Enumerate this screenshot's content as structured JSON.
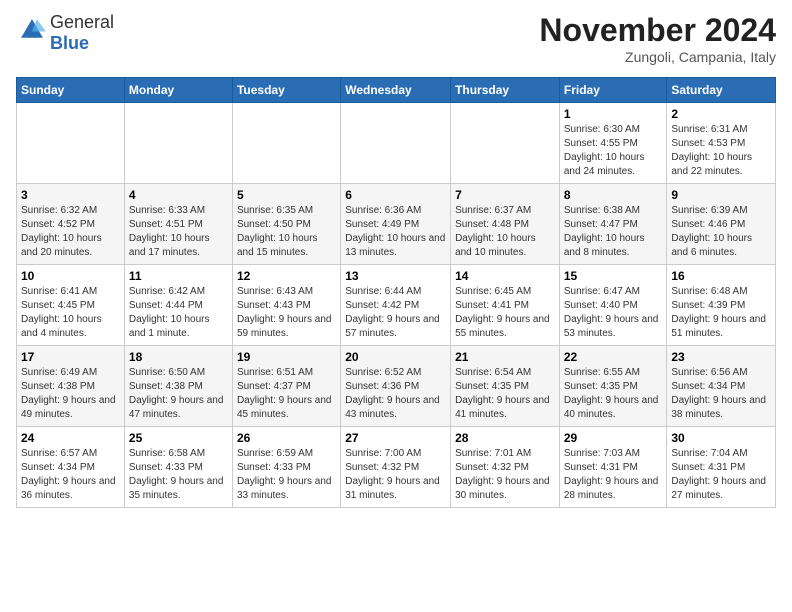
{
  "header": {
    "logo": {
      "general": "General",
      "blue": "Blue"
    },
    "title": "November 2024",
    "location": "Zungoli, Campania, Italy"
  },
  "days_header": [
    "Sunday",
    "Monday",
    "Tuesday",
    "Wednesday",
    "Thursday",
    "Friday",
    "Saturday"
  ],
  "weeks": [
    [
      {
        "day": "",
        "info": ""
      },
      {
        "day": "",
        "info": ""
      },
      {
        "day": "",
        "info": ""
      },
      {
        "day": "",
        "info": ""
      },
      {
        "day": "",
        "info": ""
      },
      {
        "day": "1",
        "info": "Sunrise: 6:30 AM\nSunset: 4:55 PM\nDaylight: 10 hours and 24 minutes."
      },
      {
        "day": "2",
        "info": "Sunrise: 6:31 AM\nSunset: 4:53 PM\nDaylight: 10 hours and 22 minutes."
      }
    ],
    [
      {
        "day": "3",
        "info": "Sunrise: 6:32 AM\nSunset: 4:52 PM\nDaylight: 10 hours and 20 minutes."
      },
      {
        "day": "4",
        "info": "Sunrise: 6:33 AM\nSunset: 4:51 PM\nDaylight: 10 hours and 17 minutes."
      },
      {
        "day": "5",
        "info": "Sunrise: 6:35 AM\nSunset: 4:50 PM\nDaylight: 10 hours and 15 minutes."
      },
      {
        "day": "6",
        "info": "Sunrise: 6:36 AM\nSunset: 4:49 PM\nDaylight: 10 hours and 13 minutes."
      },
      {
        "day": "7",
        "info": "Sunrise: 6:37 AM\nSunset: 4:48 PM\nDaylight: 10 hours and 10 minutes."
      },
      {
        "day": "8",
        "info": "Sunrise: 6:38 AM\nSunset: 4:47 PM\nDaylight: 10 hours and 8 minutes."
      },
      {
        "day": "9",
        "info": "Sunrise: 6:39 AM\nSunset: 4:46 PM\nDaylight: 10 hours and 6 minutes."
      }
    ],
    [
      {
        "day": "10",
        "info": "Sunrise: 6:41 AM\nSunset: 4:45 PM\nDaylight: 10 hours and 4 minutes."
      },
      {
        "day": "11",
        "info": "Sunrise: 6:42 AM\nSunset: 4:44 PM\nDaylight: 10 hours and 1 minute."
      },
      {
        "day": "12",
        "info": "Sunrise: 6:43 AM\nSunset: 4:43 PM\nDaylight: 9 hours and 59 minutes."
      },
      {
        "day": "13",
        "info": "Sunrise: 6:44 AM\nSunset: 4:42 PM\nDaylight: 9 hours and 57 minutes."
      },
      {
        "day": "14",
        "info": "Sunrise: 6:45 AM\nSunset: 4:41 PM\nDaylight: 9 hours and 55 minutes."
      },
      {
        "day": "15",
        "info": "Sunrise: 6:47 AM\nSunset: 4:40 PM\nDaylight: 9 hours and 53 minutes."
      },
      {
        "day": "16",
        "info": "Sunrise: 6:48 AM\nSunset: 4:39 PM\nDaylight: 9 hours and 51 minutes."
      }
    ],
    [
      {
        "day": "17",
        "info": "Sunrise: 6:49 AM\nSunset: 4:38 PM\nDaylight: 9 hours and 49 minutes."
      },
      {
        "day": "18",
        "info": "Sunrise: 6:50 AM\nSunset: 4:38 PM\nDaylight: 9 hours and 47 minutes."
      },
      {
        "day": "19",
        "info": "Sunrise: 6:51 AM\nSunset: 4:37 PM\nDaylight: 9 hours and 45 minutes."
      },
      {
        "day": "20",
        "info": "Sunrise: 6:52 AM\nSunset: 4:36 PM\nDaylight: 9 hours and 43 minutes."
      },
      {
        "day": "21",
        "info": "Sunrise: 6:54 AM\nSunset: 4:35 PM\nDaylight: 9 hours and 41 minutes."
      },
      {
        "day": "22",
        "info": "Sunrise: 6:55 AM\nSunset: 4:35 PM\nDaylight: 9 hours and 40 minutes."
      },
      {
        "day": "23",
        "info": "Sunrise: 6:56 AM\nSunset: 4:34 PM\nDaylight: 9 hours and 38 minutes."
      }
    ],
    [
      {
        "day": "24",
        "info": "Sunrise: 6:57 AM\nSunset: 4:34 PM\nDaylight: 9 hours and 36 minutes."
      },
      {
        "day": "25",
        "info": "Sunrise: 6:58 AM\nSunset: 4:33 PM\nDaylight: 9 hours and 35 minutes."
      },
      {
        "day": "26",
        "info": "Sunrise: 6:59 AM\nSunset: 4:33 PM\nDaylight: 9 hours and 33 minutes."
      },
      {
        "day": "27",
        "info": "Sunrise: 7:00 AM\nSunset: 4:32 PM\nDaylight: 9 hours and 31 minutes."
      },
      {
        "day": "28",
        "info": "Sunrise: 7:01 AM\nSunset: 4:32 PM\nDaylight: 9 hours and 30 minutes."
      },
      {
        "day": "29",
        "info": "Sunrise: 7:03 AM\nSunset: 4:31 PM\nDaylight: 9 hours and 28 minutes."
      },
      {
        "day": "30",
        "info": "Sunrise: 7:04 AM\nSunset: 4:31 PM\nDaylight: 9 hours and 27 minutes."
      }
    ]
  ]
}
